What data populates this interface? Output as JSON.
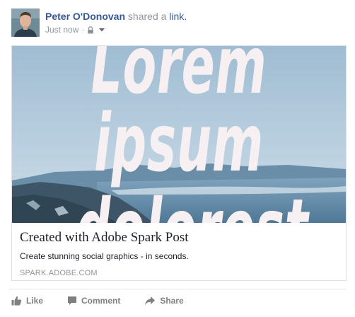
{
  "post": {
    "author_name": "Peter O'Donovan",
    "action_text": "shared a",
    "shared_object": "link.",
    "timestamp": "Just now",
    "separator": "·",
    "privacy_icon": "lock-icon",
    "privacy_menu_icon": "caret-down-icon"
  },
  "link_card": {
    "image_text": [
      "Lorem",
      "ipsum",
      "dolorest"
    ],
    "title": "Created with Adobe Spark Post",
    "description": "Create stunning social graphics - in seconds.",
    "domain": "SPARK.ADOBE.COM"
  },
  "actions": [
    {
      "label": "Like",
      "icon": "thumbs-up-icon"
    },
    {
      "label": "Comment",
      "icon": "comment-icon"
    },
    {
      "label": "Share",
      "icon": "share-arrow-icon"
    }
  ],
  "colors": {
    "link_blue": "#365899",
    "meta_gray": "#90949c",
    "action_gray": "#7f7f7f",
    "border": "#dddfe2"
  }
}
